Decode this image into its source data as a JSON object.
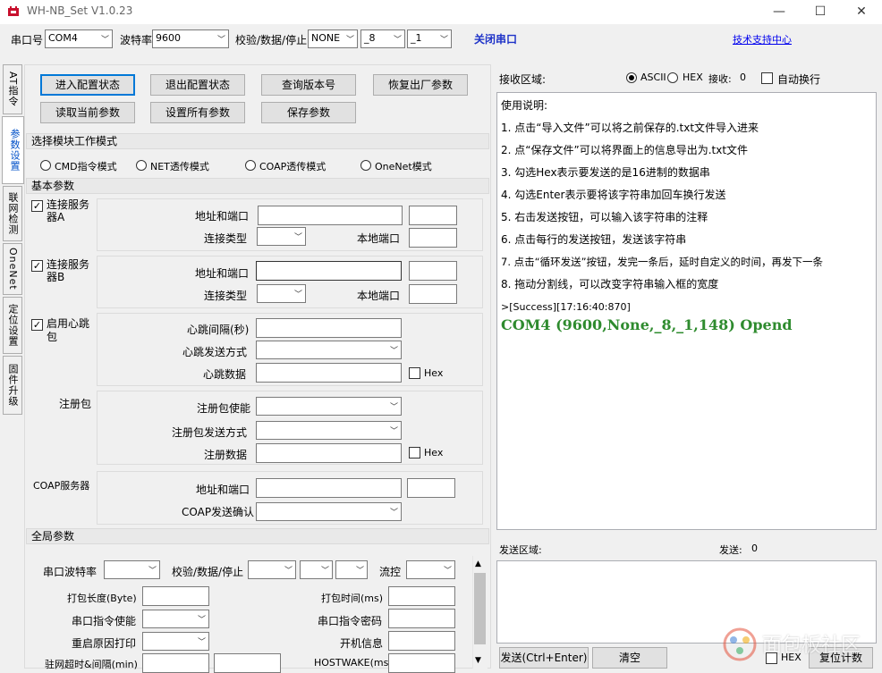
{
  "window": {
    "title": "WH-NB_Set V1.0.23",
    "minimize": "—",
    "maximize": "☐",
    "close": "✕"
  },
  "toolbar": {
    "port_label": "串口号",
    "port_value": "COM4",
    "baud_label": "波特率",
    "baud_value": "9600",
    "parity_label": "校验/数据/停止",
    "parity_value": "NONE",
    "data_value": "_8",
    "stop_value": "_1",
    "close_port": "关闭串口",
    "support_link": "技术支持中心"
  },
  "side_tabs": [
    "AT指令",
    "参数设置",
    "联网检测",
    "OneNet",
    "定位设置",
    "固件升级"
  ],
  "buttons": {
    "enter_config": "进入配置状态",
    "exit_config": "退出配置状态",
    "query_version": "查询版本号",
    "factory_reset": "恢复出厂参数",
    "read_params": "读取当前参数",
    "set_all": "设置所有参数",
    "save_params": "保存参数"
  },
  "mode": {
    "section": "选择模块工作模式",
    "options": [
      "CMD指令模式",
      "NET透传模式",
      "COAP透传模式",
      "OneNet模式"
    ]
  },
  "basic": {
    "section": "基本参数",
    "serverA": {
      "label": "连接服务器A",
      "addr": "地址和端口",
      "type": "连接类型",
      "local_port": "本地端口"
    },
    "serverB": {
      "label": "连接服务器B",
      "addr": "地址和端口",
      "type": "连接类型",
      "local_port": "本地端口"
    },
    "heartbeat": {
      "label": "启用心跳包",
      "interval": "心跳间隔(秒)",
      "send_mode": "心跳发送方式",
      "data": "心跳数据",
      "hex": "Hex"
    },
    "register": {
      "label": "注册包",
      "enable": "注册包使能",
      "send_mode": "注册包发送方式",
      "data": "注册数据",
      "hex": "Hex"
    },
    "coap": {
      "label": "COAP服务器",
      "addr": "地址和端口",
      "confirm": "COAP发送确认"
    }
  },
  "global": {
    "section": "全局参数",
    "baud": "串口波特率",
    "parity": "校验/数据/停止",
    "flow": "流控",
    "pack_len": "打包长度(Byte)",
    "pack_time": "打包时间(ms)",
    "cmd_enable": "串口指令使能",
    "cmd_password": "串口指令密码",
    "reboot_print": "重启原因打印",
    "boot_info": "开机信息",
    "timeout": "驻网超时&间隔(min)",
    "hostwake": "HOSTWAKE(ms)"
  },
  "receive": {
    "label": "接收区域:",
    "ascii": "ASCII",
    "hex": "HEX",
    "count_label": "接收:",
    "count": "0",
    "auto_wrap": "自动换行",
    "usage_title": "使用说明:",
    "usage": [
      "1. 点击“导入文件”可以将之前保存的.txt文件导入进来",
      "2. 点“保存文件”可以将界面上的信息导出为.txt文件",
      "3. 勾选Hex表示要发送的是16进制的数据串",
      "4. 勾选Enter表示要将该字符串加回车换行发送",
      "5. 右击发送按钮，可以输入该字符串的注释",
      "6. 点击每行的发送按钮，发送该字符串",
      "7. 点击“循环发送”按钮，发完一条后，延时自定义的时间，再发下一条",
      "8. 拖动分割线，可以改变字符串输入框的宽度"
    ],
    "log_time": ">[Success][17:16:40:870]",
    "log_msg": "COM4 (9600,None,_8,_1,148) Opend",
    "log_color": "#2e8b2e"
  },
  "send": {
    "label": "发送区域:",
    "count_label": "发送:",
    "count": "0",
    "send_btn": "发送(Ctrl+Enter)",
    "clear_btn": "清空",
    "hex": "HEX",
    "reset_count": "复位计数"
  },
  "watermark": "面包板社区"
}
